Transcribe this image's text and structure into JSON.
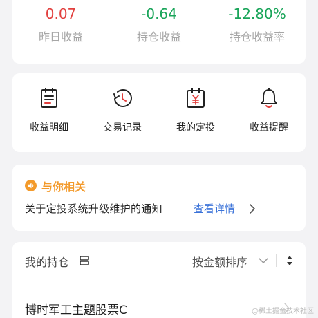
{
  "stats": [
    {
      "value": "0.07",
      "label": "昨日收益",
      "color": "#e2403e"
    },
    {
      "value": "-0.64",
      "label": "持仓收益",
      "color": "#1aa55a"
    },
    {
      "value": "-12.80%",
      "label": "持仓收益率",
      "color": "#1aa55a"
    }
  ],
  "shortcuts": [
    {
      "label": "收益明细",
      "icon": "document-icon"
    },
    {
      "label": "交易记录",
      "icon": "history-clock-icon"
    },
    {
      "label": "我的定投",
      "icon": "calendar-yen-icon"
    },
    {
      "label": "收益提醒",
      "icon": "bell-icon"
    }
  ],
  "notice": {
    "title": "与你相关",
    "text": "关于定投系统升级维护的通知",
    "link": "查看详情"
  },
  "holdings": {
    "title": "我的持仓",
    "sort_label": "按金额排序",
    "fund_name": "博时军工主题股票C"
  },
  "watermark": "@稀土掘金技术社区",
  "colors": {
    "positive": "#e2403e",
    "negative": "#1aa55a",
    "accent": "#f39a2b",
    "link": "#3b73d9"
  }
}
